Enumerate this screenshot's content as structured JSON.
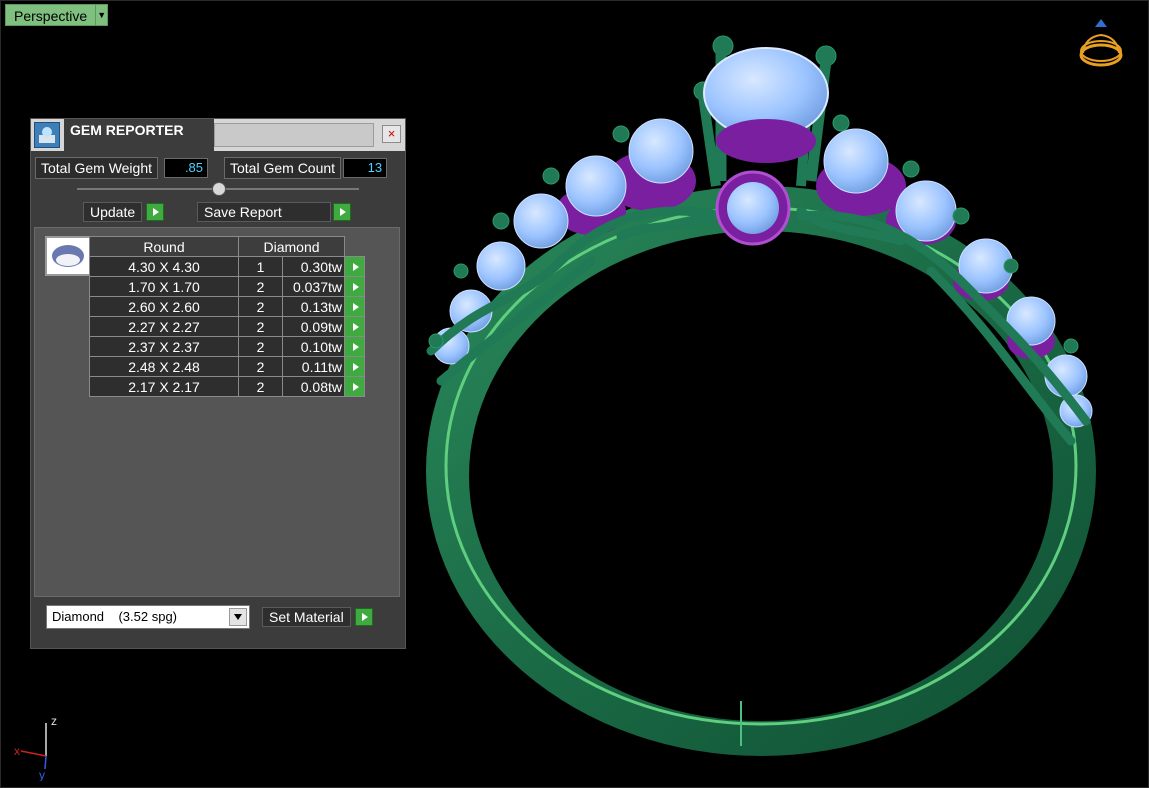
{
  "viewport": {
    "label": "Perspective"
  },
  "gem_reporter": {
    "title": "GEM REPORTER",
    "close_glyph": "×",
    "total_gem_weight_label": "Total Gem Weight",
    "total_gem_weight": ".85",
    "total_gem_count_label": "Total Gem Count",
    "total_gem_count": "13",
    "update_label": "Update",
    "save_report_label": "Save Report",
    "table": {
      "headers": [
        "Round",
        "Diamond"
      ],
      "rows": [
        {
          "size": "4.30 X 4.30",
          "qty": "1",
          "weight": "0.30tw"
        },
        {
          "size": "1.70 X 1.70",
          "qty": "2",
          "weight": "0.037tw"
        },
        {
          "size": "2.60 X 2.60",
          "qty": "2",
          "weight": "0.13tw"
        },
        {
          "size": "2.27 X 2.27",
          "qty": "2",
          "weight": "0.09tw"
        },
        {
          "size": "2.37 X 2.37",
          "qty": "2",
          "weight": "0.10tw"
        },
        {
          "size": "2.48 X 2.48",
          "qty": "2",
          "weight": "0.11tw"
        },
        {
          "size": "2.17 X 2.17",
          "qty": "2",
          "weight": "0.08tw"
        }
      ]
    },
    "material": "Diamond    (3.52 spg)",
    "set_material_label": "Set Material"
  },
  "axes": {
    "z": "z",
    "x": "x",
    "y": "y"
  },
  "colors": {
    "metal": "#1e6e4a",
    "gem": "#9cc4ff",
    "accent_gem": "#7a1fa0",
    "button_go": "#3faa3f",
    "value_text": "#4fd2ff"
  }
}
